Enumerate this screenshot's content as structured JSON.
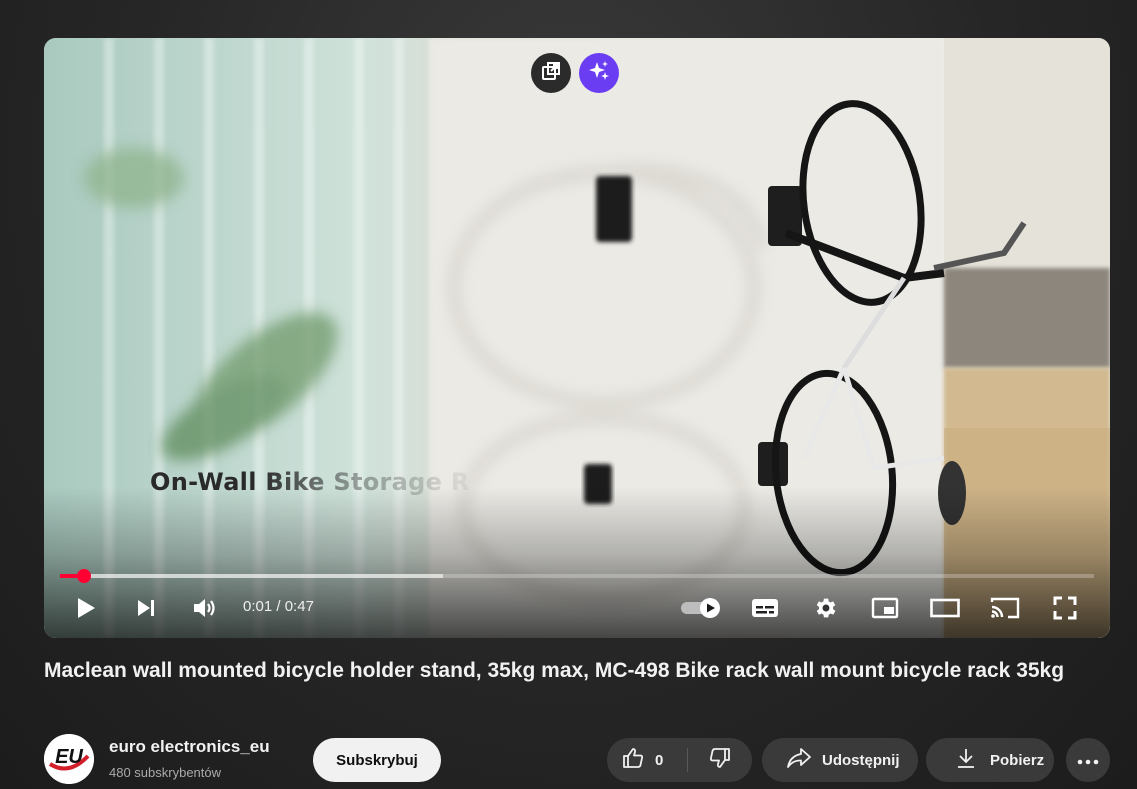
{
  "player": {
    "overlay_caption": "On-Wall Bike Storage R",
    "time_current": "0:01",
    "time_separator": "/",
    "time_total": "0:47",
    "progress": {
      "played_fraction": 0.023,
      "buffered_fraction": 0.37
    },
    "autoplay_enabled": true,
    "accent_color": "#ff0033",
    "controls": [
      "play-icon",
      "next-icon",
      "volume-icon",
      "autoplay-toggle",
      "subtitles-icon",
      "settings-icon",
      "miniplayer-icon",
      "theater-icon",
      "cast-icon",
      "fullscreen-icon"
    ],
    "top_chips": [
      "popout-icon",
      "sparkle-icon"
    ]
  },
  "video": {
    "title": "Maclean wall mounted bicycle holder stand, 35kg max, MC-498 Bike rack wall mount bicycle rack 35kg"
  },
  "channel": {
    "name": "euro electronics_eu",
    "subscribers": "480 subskrybentów",
    "avatar_text": "EU"
  },
  "actions": {
    "subscribe_label": "Subskrybuj",
    "like_count": "0",
    "share_label": "Udostępnij",
    "download_label": "Pobierz"
  }
}
